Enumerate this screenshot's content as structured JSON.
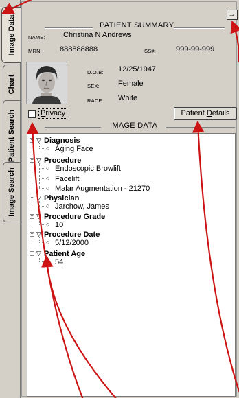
{
  "tabs": [
    {
      "label": "Image Data",
      "active": true
    },
    {
      "label": "Chart",
      "active": false
    },
    {
      "label": "Patient Search",
      "active": false
    },
    {
      "label": "Image Search",
      "active": false
    }
  ],
  "patient_summary": {
    "title": "PATIENT SUMMARY",
    "arrow_button": "→",
    "name_label": "NAME:",
    "name": "Christina N Andrews",
    "mrn_label": "MRN:",
    "mrn": "888888888",
    "ss_label": "SS#:",
    "ss": "999-99-999",
    "dob_label": "D.O.B:",
    "dob": "12/25/1947",
    "sex_label": "SEX:",
    "sex": "Female",
    "race_label": "RACE:",
    "race": "White"
  },
  "privacy_label": "Privacy",
  "patient_details_button": "Patient Details",
  "image_data": {
    "title": "IMAGE DATA",
    "groups": [
      {
        "label": "Diagnosis",
        "items": [
          "Aging Face"
        ]
      },
      {
        "label": "Procedure",
        "items": [
          "Endoscopic Browlift",
          "Facelift",
          "Malar Augmentation - 21270"
        ]
      },
      {
        "label": "Physician",
        "items": [
          "Jarchow, James"
        ]
      },
      {
        "label": "Procedure Grade",
        "items": [
          "10"
        ]
      },
      {
        "label": "Procedure Date",
        "items": [
          "5/12/2000"
        ]
      },
      {
        "label": "Patient Age",
        "items": [
          "54"
        ]
      }
    ]
  },
  "icons": {
    "expander": "−",
    "triangle": "▽",
    "bullet": "○"
  },
  "annotation_color": "#cc1414"
}
